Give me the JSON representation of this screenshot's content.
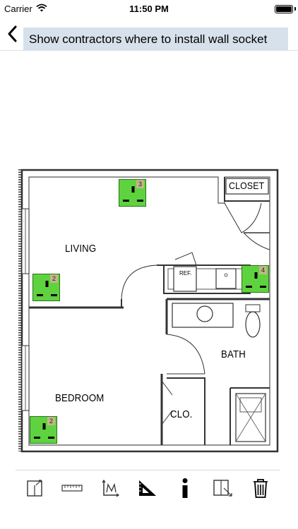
{
  "status_bar": {
    "carrier": "Carrier",
    "time": "11:50 PM",
    "battery_level": 1.0
  },
  "nav": {
    "title": "Show contractors where to install wall socket"
  },
  "floorplan": {
    "rooms": {
      "living": "LIVING",
      "bedroom": "BEDROOM",
      "bath": "BATH",
      "closet": "CLOSET",
      "clo": "CLO.",
      "ref": "REF."
    },
    "sockets": [
      {
        "number": "3"
      },
      {
        "number": "2"
      },
      {
        "number": "4"
      },
      {
        "number": "2"
      }
    ],
    "socket_color": "#5fd33f"
  },
  "toolbar": {
    "tools": [
      {
        "icon": "door-icon"
      },
      {
        "icon": "ruler-icon"
      },
      {
        "icon": "chart-axis-icon"
      },
      {
        "icon": "set-square-icon"
      },
      {
        "icon": "info-icon"
      },
      {
        "icon": "resize-panel-icon"
      },
      {
        "icon": "trash-icon"
      }
    ]
  }
}
